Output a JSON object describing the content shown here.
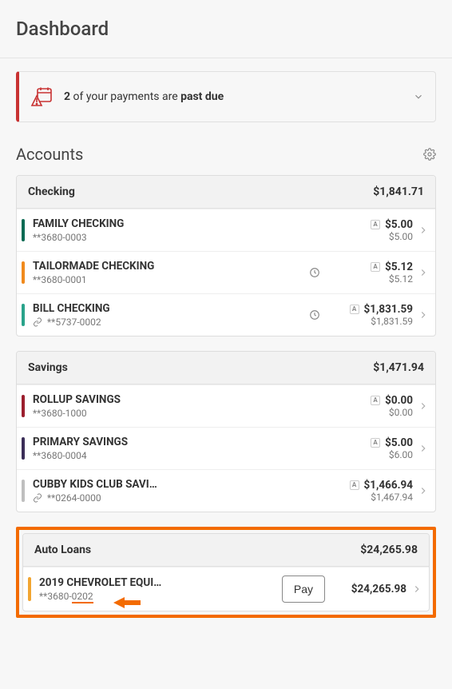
{
  "page": {
    "title": "Dashboard"
  },
  "alert": {
    "count": "2",
    "mid": " of your payments are ",
    "suffix": "past due"
  },
  "accounts": {
    "heading": "Accounts"
  },
  "groups": {
    "checking": {
      "name": "Checking",
      "total": "$1,841.71",
      "rows": [
        {
          "name": "FAMILY CHECKING",
          "sub": "**3680-0003",
          "amt1": "$5.00",
          "amt2": "$5.00",
          "color": "#0a6b54"
        },
        {
          "name": "TAILORMADE CHECKING",
          "sub": "**3680-0001",
          "amt1": "$5.12",
          "amt2": "$5.12",
          "color": "#f08a1d",
          "clock": true
        },
        {
          "name": "BILL CHECKING",
          "sub": "**5737-0002",
          "amt1": "$1,831.59",
          "amt2": "$1,831.59",
          "color": "#2aa38b",
          "clock": true,
          "linked": true
        }
      ]
    },
    "savings": {
      "name": "Savings",
      "total": "$1,471.94",
      "rows": [
        {
          "name": "ROLLUP SAVINGS",
          "sub": "**3680-1000",
          "amt1": "$0.00",
          "amt2": "$0.00",
          "color": "#9c1f2e"
        },
        {
          "name": "PRIMARY SAVINGS",
          "sub": "**3680-0004",
          "amt1": "$5.00",
          "amt2": "$6.00",
          "color": "#3b2e58"
        },
        {
          "name": "CUBBY KIDS CLUB SAVI…",
          "sub": "**0264-0000",
          "amt1": "$1,466.94",
          "amt2": "$1,467.94",
          "color": "#bfbfbf",
          "linked": true
        }
      ]
    },
    "auto": {
      "name": "Auto Loans",
      "total": "$24,265.98",
      "rows": [
        {
          "name": "2019 CHEVROLET EQUI…",
          "sub_pre": "**3680-",
          "sub_hl": "0202",
          "amt1": "$24,265.98",
          "color": "#f2a531",
          "pay": "Pay"
        }
      ]
    }
  }
}
